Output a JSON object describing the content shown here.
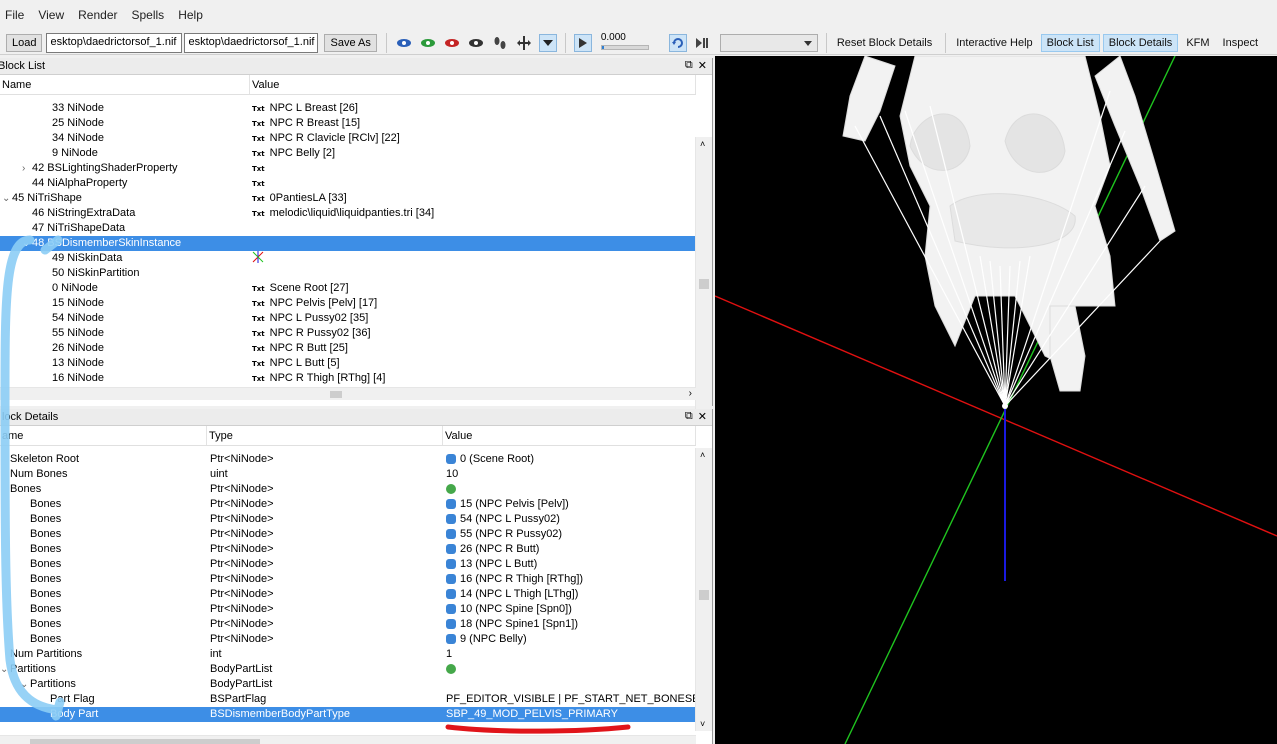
{
  "menu": [
    "File",
    "View",
    "Render",
    "Spells",
    "Help"
  ],
  "toolbar": {
    "load_label": "Load",
    "path1": "esktop\\daedrictorsof_1.nif",
    "path2": "esktop\\daedrictorsof_1.nif",
    "saveas_label": "Save As",
    "time_value": "0.000",
    "time_progress": 0.05,
    "right_buttons": [
      "Reset Block Details",
      "Interactive Help",
      "Block List",
      "Block Details",
      "KFM",
      "Inspect"
    ]
  },
  "block_list": {
    "title": "Block List",
    "col_name": "Name",
    "col_value": "Value",
    "rows": [
      {
        "indent": 3,
        "arrow": "",
        "name": "33 NiNode",
        "txt": true,
        "value": "NPC L Breast [26]"
      },
      {
        "indent": 3,
        "arrow": "",
        "name": "25 NiNode",
        "txt": true,
        "value": "NPC R Breast [15]"
      },
      {
        "indent": 3,
        "arrow": "",
        "name": "34 NiNode",
        "txt": true,
        "value": "NPC R Clavicle [RClv] [22]"
      },
      {
        "indent": 3,
        "arrow": "",
        "name": "9 NiNode",
        "txt": true,
        "value": "NPC Belly [2]"
      },
      {
        "indent": 2,
        "arrow": ">",
        "name": "42 BSLightingShaderProperty",
        "txt": true,
        "value": ""
      },
      {
        "indent": 2,
        "arrow": "",
        "name": "44 NiAlphaProperty",
        "txt": true,
        "value": ""
      },
      {
        "indent": 1,
        "arrow": "v",
        "name": "45 NiTriShape",
        "txt": true,
        "value": "0PantiesLA [33]"
      },
      {
        "indent": 2,
        "arrow": "",
        "name": "46 NiStringExtraData",
        "txt": true,
        "value": "melodic\\liquid\\liquidpanties.tri [34]"
      },
      {
        "indent": 2,
        "arrow": "",
        "name": "47 NiTriShapeData",
        "txt": false,
        "value": ""
      },
      {
        "indent": 2,
        "arrow": "v",
        "name": "48 BSDismemberSkinInstance",
        "txt": false,
        "value": "",
        "selected": true
      },
      {
        "indent": 3,
        "arrow": "",
        "name": "49 NiSkinData",
        "txt": false,
        "value": "",
        "icon": "node-axes-icon"
      },
      {
        "indent": 3,
        "arrow": "",
        "name": "50 NiSkinPartition",
        "txt": false,
        "value": ""
      },
      {
        "indent": 3,
        "arrow": "",
        "name": "0 NiNode",
        "txt": true,
        "value": "Scene Root [27]"
      },
      {
        "indent": 3,
        "arrow": "",
        "name": "15 NiNode",
        "txt": true,
        "value": "NPC Pelvis [Pelv] [17]"
      },
      {
        "indent": 3,
        "arrow": "",
        "name": "54 NiNode",
        "txt": true,
        "value": "NPC L Pussy02 [35]"
      },
      {
        "indent": 3,
        "arrow": "",
        "name": "55 NiNode",
        "txt": true,
        "value": "NPC R Pussy02 [36]"
      },
      {
        "indent": 3,
        "arrow": "",
        "name": "26 NiNode",
        "txt": true,
        "value": "NPC R Butt [25]"
      },
      {
        "indent": 3,
        "arrow": "",
        "name": "13 NiNode",
        "txt": true,
        "value": "NPC L Butt [5]"
      },
      {
        "indent": 3,
        "arrow": "",
        "name": "16 NiNode",
        "txt": true,
        "value": "NPC R Thigh [RThg] [4]"
      }
    ]
  },
  "block_details": {
    "title": "lock Details",
    "col_name": "ame",
    "col_type": "Type",
    "col_value": "Value",
    "rows": [
      {
        "indent": 1,
        "arrow": "",
        "name": "Skeleton Root",
        "type": "Ptr<NiNode>",
        "icon": "link",
        "value": "0 (Scene Root)"
      },
      {
        "indent": 1,
        "arrow": "",
        "name": "Num Bones",
        "type": "uint",
        "icon": "",
        "value": "10"
      },
      {
        "indent": 1,
        "arrow": "",
        "name": "Bones",
        "type": "Ptr<NiNode>",
        "icon": "array",
        "value": ""
      },
      {
        "indent": 2,
        "arrow": "",
        "name": "Bones",
        "type": "Ptr<NiNode>",
        "icon": "link",
        "value": "15 (NPC Pelvis [Pelv])"
      },
      {
        "indent": 2,
        "arrow": "",
        "name": "Bones",
        "type": "Ptr<NiNode>",
        "icon": "link",
        "value": "54 (NPC L Pussy02)"
      },
      {
        "indent": 2,
        "arrow": "",
        "name": "Bones",
        "type": "Ptr<NiNode>",
        "icon": "link",
        "value": "55 (NPC R Pussy02)"
      },
      {
        "indent": 2,
        "arrow": "",
        "name": "Bones",
        "type": "Ptr<NiNode>",
        "icon": "link",
        "value": "26 (NPC R Butt)"
      },
      {
        "indent": 2,
        "arrow": "",
        "name": "Bones",
        "type": "Ptr<NiNode>",
        "icon": "link",
        "value": "13 (NPC L Butt)"
      },
      {
        "indent": 2,
        "arrow": "",
        "name": "Bones",
        "type": "Ptr<NiNode>",
        "icon": "link",
        "value": "16 (NPC R Thigh [RThg])"
      },
      {
        "indent": 2,
        "arrow": "",
        "name": "Bones",
        "type": "Ptr<NiNode>",
        "icon": "link",
        "value": "14 (NPC L Thigh [LThg])"
      },
      {
        "indent": 2,
        "arrow": "",
        "name": "Bones",
        "type": "Ptr<NiNode>",
        "icon": "link",
        "value": "10 (NPC Spine [Spn0])"
      },
      {
        "indent": 2,
        "arrow": "",
        "name": "Bones",
        "type": "Ptr<NiNode>",
        "icon": "link",
        "value": "18 (NPC Spine1 [Spn1])"
      },
      {
        "indent": 2,
        "arrow": "",
        "name": "Bones",
        "type": "Ptr<NiNode>",
        "icon": "link",
        "value": "9 (NPC Belly)"
      },
      {
        "indent": 1,
        "arrow": "",
        "name": "Num Partitions",
        "type": "int",
        "icon": "",
        "value": "1"
      },
      {
        "indent": 1,
        "arrow": "v",
        "name": "Partitions",
        "type": "BodyPartList",
        "icon": "array",
        "value": ""
      },
      {
        "indent": 2,
        "arrow": "v",
        "name": "Partitions",
        "type": "BodyPartList",
        "icon": "",
        "value": ""
      },
      {
        "indent": 3,
        "arrow": "",
        "name": "Part Flag",
        "type": "BSPartFlag",
        "icon": "",
        "value": "PF_EDITOR_VISIBLE | PF_START_NET_BONESET"
      },
      {
        "indent": 3,
        "arrow": "",
        "name": "Body Part",
        "type": "BSDismemberBodyPartType",
        "icon": "",
        "value": "SBP_49_MOD_PELVIS_PRIMARY",
        "selected": true
      }
    ]
  },
  "colors": {
    "selection": "#3d8ee6",
    "annotation_blue": "#8ccdf5",
    "annotation_red": "#e0141a",
    "axis_x": "#e01010",
    "axis_y": "#1fc41f",
    "axis_z": "#1a1ae0"
  }
}
